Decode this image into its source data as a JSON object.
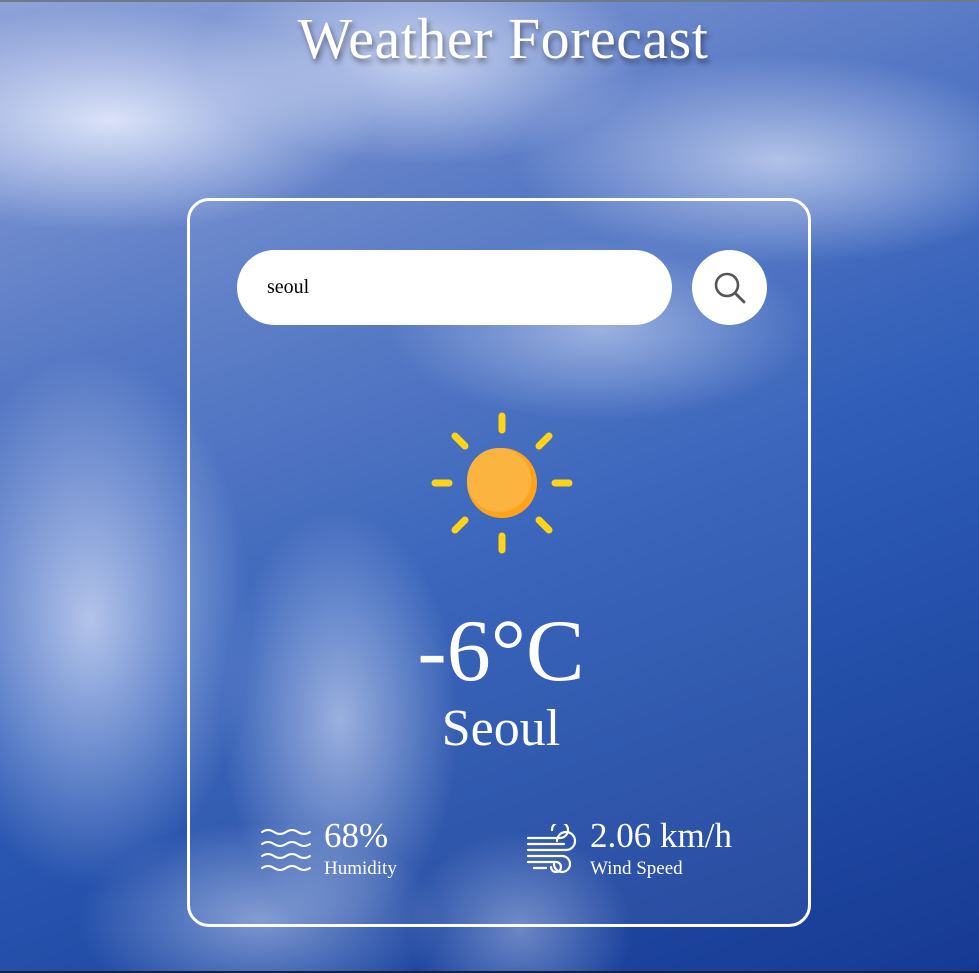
{
  "page": {
    "title": "Weather Forecast"
  },
  "search": {
    "value": "seoul",
    "icon": "search-icon"
  },
  "weather": {
    "icon": "sun-icon",
    "temperature": "-6°C",
    "city": "Seoul"
  },
  "details": {
    "humidity": {
      "icon": "humidity-waves-icon",
      "value": "68%",
      "label": "Humidity"
    },
    "wind": {
      "icon": "wind-icon",
      "value": "2.06 km/h",
      "label": "Wind Speed"
    }
  },
  "colors": {
    "sun_core": "#F9AE3C",
    "sun_rays": "#FFD316",
    "card_border": "#FFFFFF",
    "search_icon": "#555555"
  }
}
